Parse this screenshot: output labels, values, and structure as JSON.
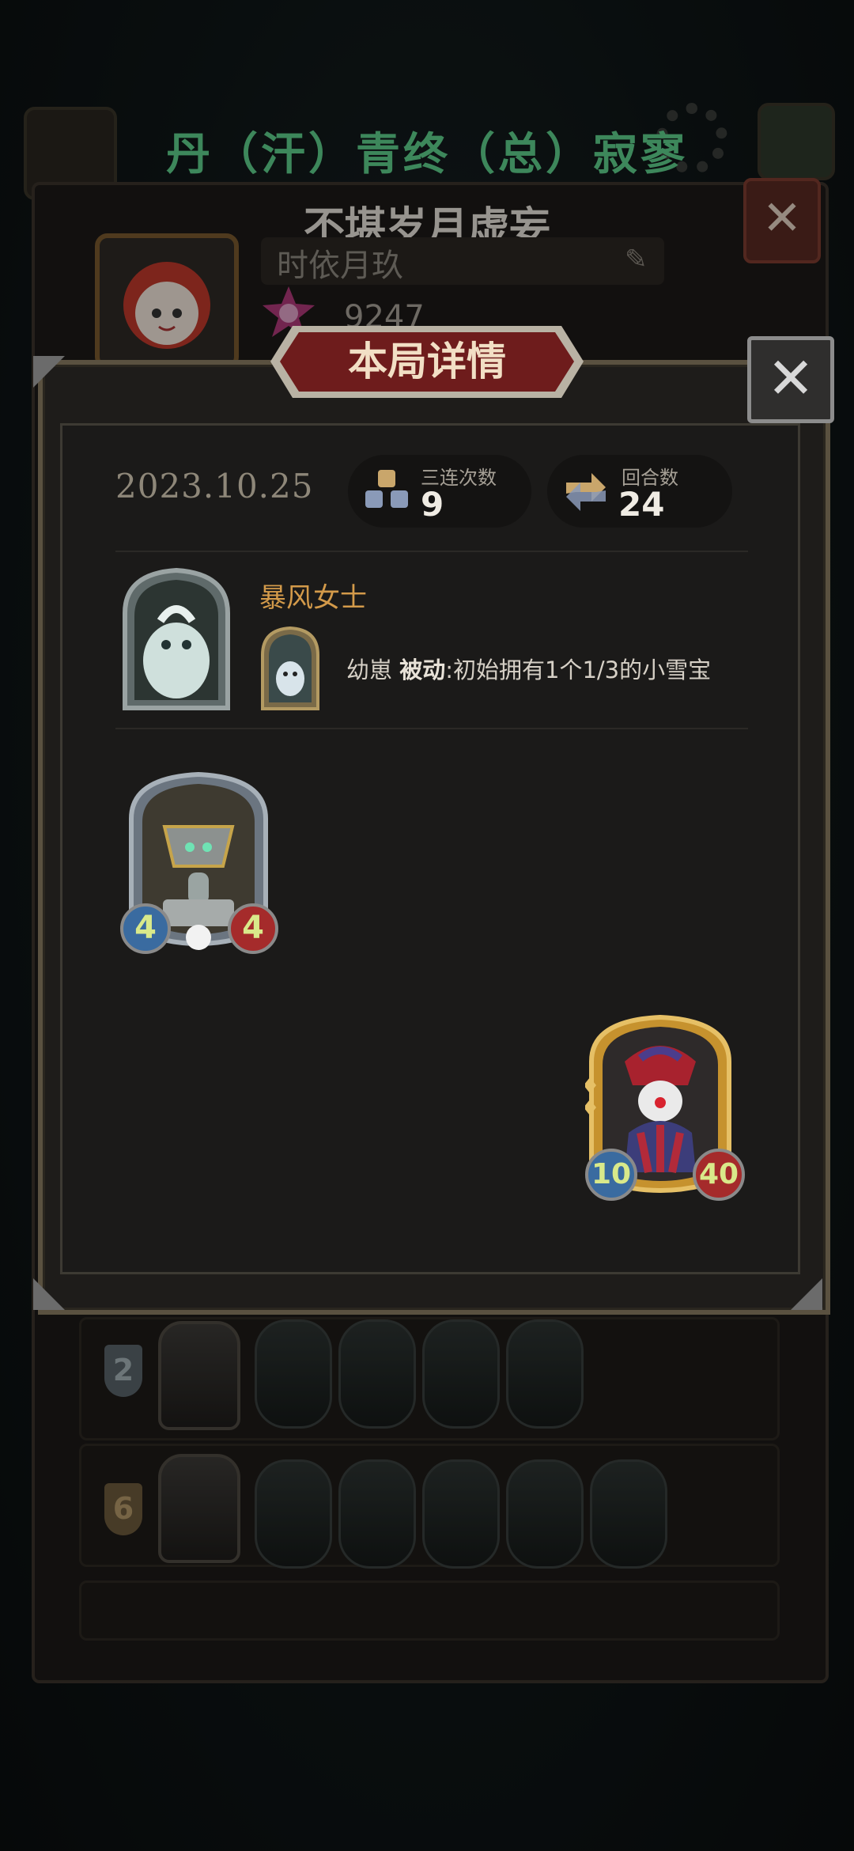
{
  "background": {
    "top_title": "丹（汗）青终（总）寂寥"
  },
  "profile": {
    "name": "不堪岁月虚妄",
    "signature": "时依月玖",
    "score": "9247",
    "close_label": "✕"
  },
  "modal": {
    "title": "本局详情",
    "close_label": "✕",
    "date": "2023.10.25",
    "stats": [
      {
        "label": "三连次数",
        "value": "9",
        "icon": "triple-icon"
      },
      {
        "label": "回合数",
        "value": "24",
        "icon": "round-icon"
      }
    ],
    "hero": {
      "name": "暴风女士",
      "skill_prefix": "幼崽 ",
      "skill_type": "被动",
      "skill_desc": ":初始拥有1个1/3的小雪宝"
    },
    "cards": [
      {
        "name": "robot-card",
        "attack": "4",
        "health": "4"
      },
      {
        "name": "clown-card",
        "attack": "10",
        "health": "40"
      }
    ]
  },
  "history": [
    {
      "tier": "2",
      "tier_style": "silver"
    },
    {
      "tier": "6",
      "tier_style": "gold"
    }
  ],
  "colors": {
    "accent_green": "#5fd08d",
    "hero_name": "#d39a4a",
    "banner_red": "#6e1c1c"
  }
}
